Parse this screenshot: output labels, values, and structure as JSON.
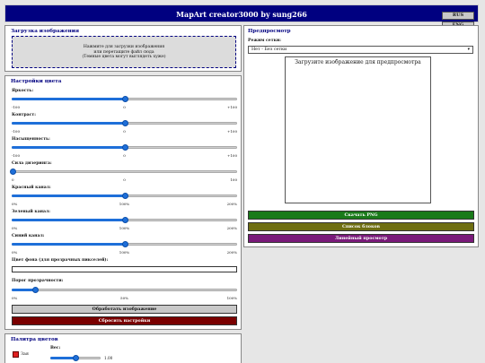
{
  "header": {
    "title": "MapArt creator3000 by sung266"
  },
  "lang": {
    "ru": "RUS",
    "en": "ENG"
  },
  "upload": {
    "title": "Загрузка изображения",
    "line1": "Нажмите для загрузки изображения",
    "line2": "или перетащите файл сюда",
    "line3": "(Темные цвета могут выглядеть хуже)"
  },
  "colors": {
    "title": "Настройки цвета",
    "sliders": [
      {
        "label": "Яркость:",
        "min": "-100",
        "mid": "0",
        "max": "+100",
        "value": 0.5
      },
      {
        "label": "Контраст:",
        "min": "-100",
        "mid": "0",
        "max": "+100",
        "value": 0.5
      },
      {
        "label": "Насыщенность:",
        "min": "-100",
        "mid": "0",
        "max": "+100",
        "value": 0.5
      },
      {
        "label": "Сила дизеринга:",
        "min": "0",
        "mid": "0",
        "max": "100",
        "value": 0.0
      },
      {
        "label": "Красный канал:",
        "min": "0%",
        "mid": "100%",
        "max": "200%",
        "value": 0.5
      },
      {
        "label": "Зеленый канал:",
        "min": "0%",
        "mid": "100%",
        "max": "200%",
        "value": 0.5
      },
      {
        "label": "Синий канал:",
        "min": "0%",
        "mid": "100%",
        "max": "200%",
        "value": 0.5
      }
    ],
    "bg_label": "Цвет фона (для прозрачных пикселей):",
    "threshold": {
      "label": "Порог прозрачности:",
      "min": "0%",
      "mid": "50%",
      "max": "100%",
      "value": 0.1
    },
    "process_button": "Обработать изображение",
    "reset_button": "Сбросить настройки"
  },
  "preview": {
    "title": "Предпросмотр",
    "grid_label": "Режим сетки:",
    "grid_value": "Нет - Без сетки",
    "placeholder": "Загрузите изображение для предпросмотра",
    "download_button": "Скачать PNG",
    "blocks_button": "Список блоков",
    "layer_button": "Линейный просмотр",
    "download_color": "#1a7a1a",
    "blocks_color": "#6e6e12",
    "layer_color": "#7a1a7a"
  },
  "palette": {
    "title": "Палитра цветов",
    "weight_label": "Вес:",
    "item_name": "Зая",
    "weight_value": "1.00",
    "weight": 0.5,
    "swatch_color": "#e02020"
  },
  "accent_color": "#000080",
  "reset_color": "#7a0000"
}
